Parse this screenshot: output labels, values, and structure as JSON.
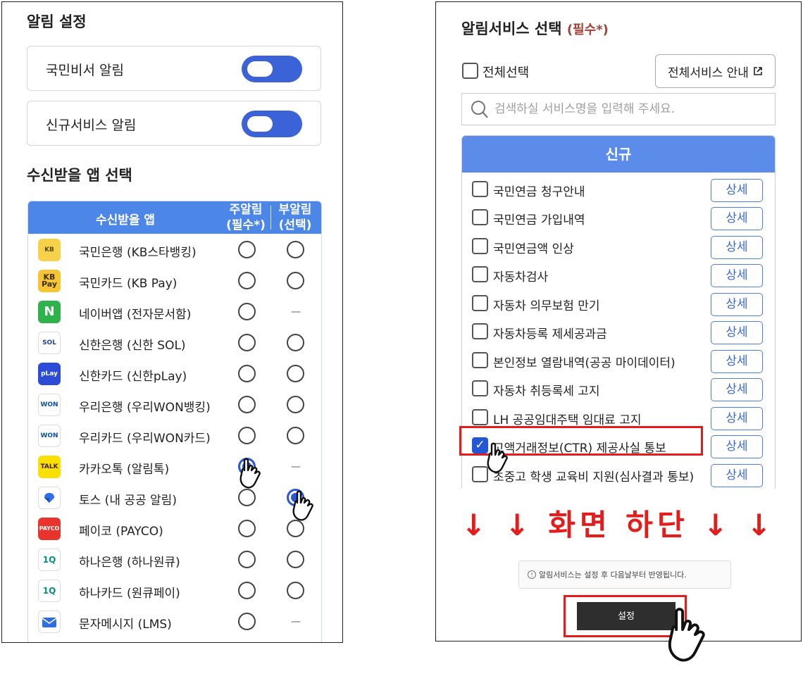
{
  "alarm_settings": {
    "title": "알림 설정",
    "toggles": [
      {
        "label": "국민비서 알림",
        "on": true
      },
      {
        "label": "신규서비스 알림",
        "on": true
      }
    ]
  },
  "app_select": {
    "title": "수신받을 앱 선택",
    "headers": {
      "app": "수신받을 앱",
      "main_line1": "주알림",
      "main_line2": "(필수*)",
      "sub_line1": "부알림",
      "sub_line2": "(선택)"
    },
    "apps": [
      {
        "name": "국민은행 (KB스타뱅킹)",
        "icon": "kb-bank-icon",
        "icon_text": "KB",
        "main": false,
        "sub": false
      },
      {
        "name": "국민카드 (KB Pay)",
        "icon": "kb-pay-icon",
        "icon_text": "KB Pay",
        "main": false,
        "sub": false
      },
      {
        "name": "네이버앱 (전자문서함)",
        "icon": "naver-icon",
        "icon_text": "N",
        "main": false,
        "sub": null
      },
      {
        "name": "신한은행 (신한 SOL)",
        "icon": "shinhan-sol-icon",
        "icon_text": "SOL",
        "main": false,
        "sub": false
      },
      {
        "name": "신한카드 (신한pLay)",
        "icon": "shinhan-play-icon",
        "icon_text": "pLay",
        "main": false,
        "sub": false
      },
      {
        "name": "우리은행 (우리WON뱅킹)",
        "icon": "woori-won-icon",
        "icon_text": "WON",
        "main": false,
        "sub": false
      },
      {
        "name": "우리카드 (우리WON카드)",
        "icon": "woori-card-icon",
        "icon_text": "WON",
        "main": false,
        "sub": false
      },
      {
        "name": "카카오톡 (알림톡)",
        "icon": "kakaotalk-icon",
        "icon_text": "TALK",
        "main": true,
        "sub": null
      },
      {
        "name": "토스 (내 공공 알림)",
        "icon": "toss-icon",
        "icon_text": "",
        "main": false,
        "sub": true
      },
      {
        "name": "페이코 (PAYCO)",
        "icon": "payco-icon",
        "icon_text": "PAYCO",
        "main": false,
        "sub": false
      },
      {
        "name": "하나은행 (하나원큐)",
        "icon": "hana-bank-icon",
        "icon_text": "1Q",
        "main": false,
        "sub": false
      },
      {
        "name": "하나카드 (원큐페이)",
        "icon": "hana-card-icon",
        "icon_text": "1Q",
        "main": false,
        "sub": false
      },
      {
        "name": "문자메시지 (LMS)",
        "icon": "sms-icon",
        "icon_text": "",
        "main": false,
        "sub": null
      }
    ],
    "dash": "—"
  },
  "service_select": {
    "title": "알림서비스 선택",
    "required_mark": "(필수*)",
    "select_all_label": "전체선택",
    "guide_button": "전체서비스 안내",
    "search_placeholder": "검색하실 서비스명을 입력해 주세요.",
    "group_header": "신규",
    "detail_label": "상세",
    "services": [
      {
        "name": "국민연금 청구안내",
        "checked": false
      },
      {
        "name": "국민연금 가입내역",
        "checked": false
      },
      {
        "name": "국민연금액 인상",
        "checked": false
      },
      {
        "name": "자동차검사",
        "checked": false
      },
      {
        "name": "자동차 의무보험 만기",
        "checked": false
      },
      {
        "name": "자동차등록 제세공과금",
        "checked": false
      },
      {
        "name": "본인정보 열람내역(공공 마이데이터)",
        "checked": false
      },
      {
        "name": "자동차 취등록세 고지",
        "checked": false
      },
      {
        "name": "LH 공공임대주택 임대료 고지",
        "checked": false
      },
      {
        "name": "고액거래정보(CTR) 제공사실 통보",
        "checked": true
      },
      {
        "name": "초중고 학생 교육비 지원(심사결과 통보)",
        "checked": false
      }
    ],
    "bottom_marker": "↓ ↓ 화면 하단 ↓ ↓",
    "notice": "알림서비스는 설정 후 다음날부터 반영됩니다.",
    "submit_label": "설정"
  },
  "colors": {
    "accent_blue": "#3b62d6",
    "header_blue": "#4c86e6",
    "highlight_red": "#e31c1c"
  }
}
